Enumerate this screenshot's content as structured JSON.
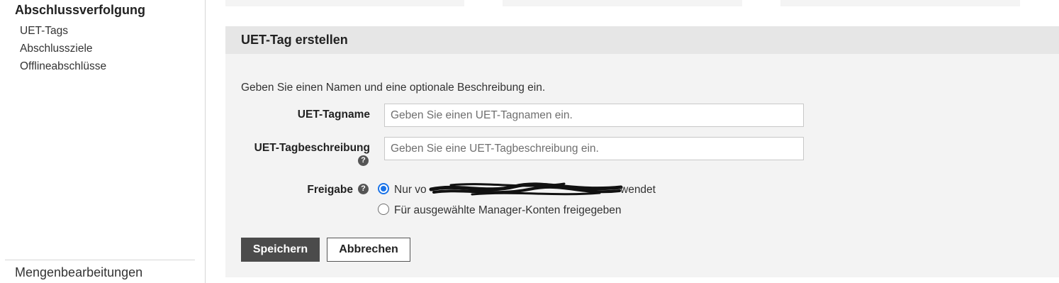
{
  "sidebar": {
    "section_title": "Abschlussverfolgung",
    "items": [
      {
        "label": "UET-Tags"
      },
      {
        "label": "Abschlussziele"
      },
      {
        "label": "Offlineabschlüsse"
      }
    ],
    "bottom_item": "Mengenbearbeitungen"
  },
  "form": {
    "title": "UET-Tag erstellen",
    "instruction": "Geben Sie einen Namen und eine optionale Beschreibung ein.",
    "name_label": "UET-Tagname",
    "name_placeholder": "Geben Sie einen UET-Tagnamen ein.",
    "name_value": "",
    "description_label": "UET-Tagbeschreibung",
    "description_placeholder": "Geben Sie eine UET-Tagbeschreibung ein.",
    "description_value": "",
    "sharing_label": "Freigabe",
    "sharing_options": [
      {
        "visible_start": "Nur vo",
        "visible_end": "wendet",
        "selected": true,
        "redacted": true
      },
      {
        "label": "Für ausgewählte Manager-Konten freigegeben",
        "selected": false
      }
    ],
    "save_label": "Speichern",
    "cancel_label": "Abbrechen"
  },
  "icons": {
    "help": "question-circle-icon"
  },
  "colors": {
    "primary_button": "#4b4b4b",
    "radio_accent": "#1a73e8",
    "panel_bg": "#f3f3f3",
    "panel_header_bg": "#e6e6e6"
  }
}
